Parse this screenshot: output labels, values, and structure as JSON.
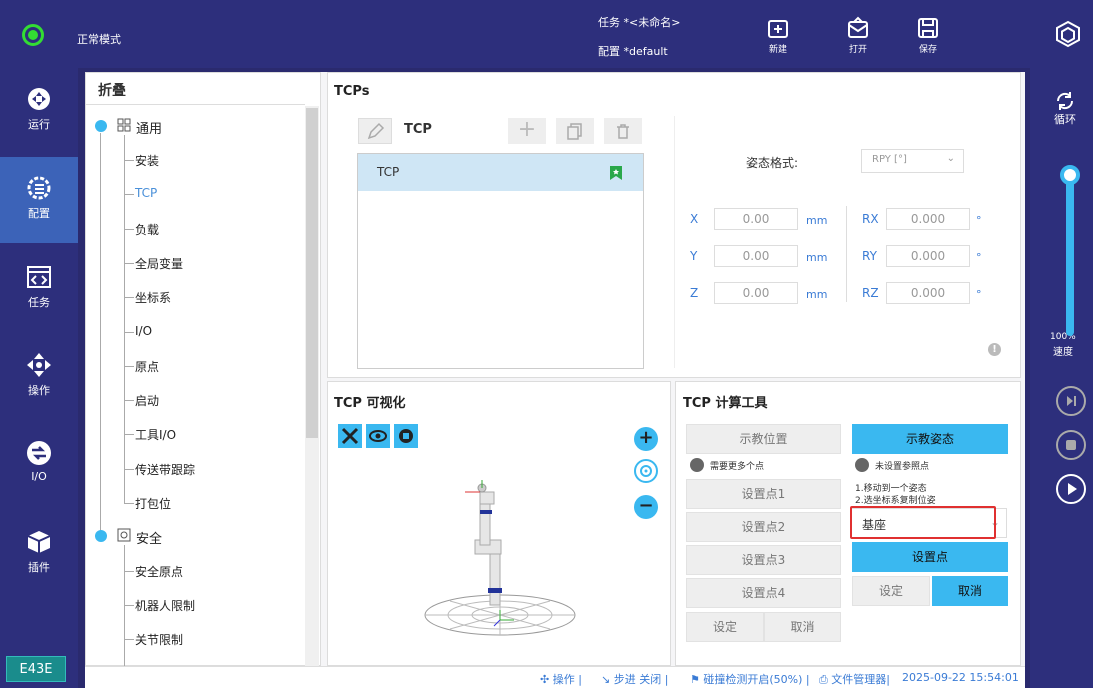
{
  "topbar": {
    "mode": "正常模式",
    "task_label": "任务",
    "task_value": "*<未命名>",
    "config_label": "配置",
    "config_value": "*default",
    "new_label": "新建",
    "open_label": "打开",
    "save_label": "保存"
  },
  "rail": {
    "items": [
      {
        "label": "运行",
        "icon": "run-icon"
      },
      {
        "label": "配置",
        "icon": "config-icon"
      },
      {
        "label": "任务",
        "icon": "task-icon"
      },
      {
        "label": "操作",
        "icon": "move-icon"
      },
      {
        "label": "I/O",
        "icon": "io-icon"
      },
      {
        "label": "插件",
        "icon": "plugin-icon"
      }
    ],
    "code": "E43E"
  },
  "right": {
    "loop_label": "循环",
    "speed_value": "100%",
    "speed_label": "速度",
    "speed_fraction": 1.0
  },
  "tree": {
    "header": "折叠",
    "general": "通用",
    "general_items": [
      "安装",
      "TCP",
      "负载",
      "全局变量",
      "坐标系",
      "I/O",
      "原点",
      "启动",
      "工具I/O",
      "传送带跟踪",
      "打包位"
    ],
    "safety": "安全",
    "safety_items": [
      "安全原点",
      "机器人限制",
      "关节限制"
    ]
  },
  "tcps": {
    "title": "TCPs",
    "current": "TCP",
    "list": [
      "TCP"
    ],
    "pose_format_label": "姿态格式:",
    "pose_format_value": "RPY [°]",
    "fields": {
      "x": {
        "label": "X",
        "value": "0.00",
        "unit": "mm"
      },
      "y": {
        "label": "Y",
        "value": "0.00",
        "unit": "mm"
      },
      "z": {
        "label": "Z",
        "value": "0.00",
        "unit": "mm"
      },
      "rx": {
        "label": "RX",
        "value": "0.000",
        "unit": "°"
      },
      "ry": {
        "label": "RY",
        "value": "0.000",
        "unit": "°"
      },
      "rz": {
        "label": "RZ",
        "value": "0.000",
        "unit": "°"
      }
    }
  },
  "viz": {
    "title": "TCP 可视化"
  },
  "calc": {
    "title": "TCP 计算工具",
    "teach_position": "示教位置",
    "teach_pose": "示教姿态",
    "need_points": "需要更多个点",
    "no_ref": "未设置参照点",
    "step1": "1.移动到一个姿态",
    "step2": "2.选坐标系复制位姿",
    "set_point_1": "设置点1",
    "set_point_2": "设置点2",
    "set_point_3": "设置点3",
    "set_point_4": "设置点4",
    "set_left": "设定",
    "cancel_left": "取消",
    "frame_select": "基座",
    "set_point": "设置点",
    "set_right": "设定",
    "cancel_right": "取消"
  },
  "footer": {
    "operate": "操作",
    "step": "步进 关闭",
    "collision": "碰撞检测开启(50%)",
    "file_manager": "文件管理器",
    "datetime": "2025-09-22 15:54:01"
  }
}
